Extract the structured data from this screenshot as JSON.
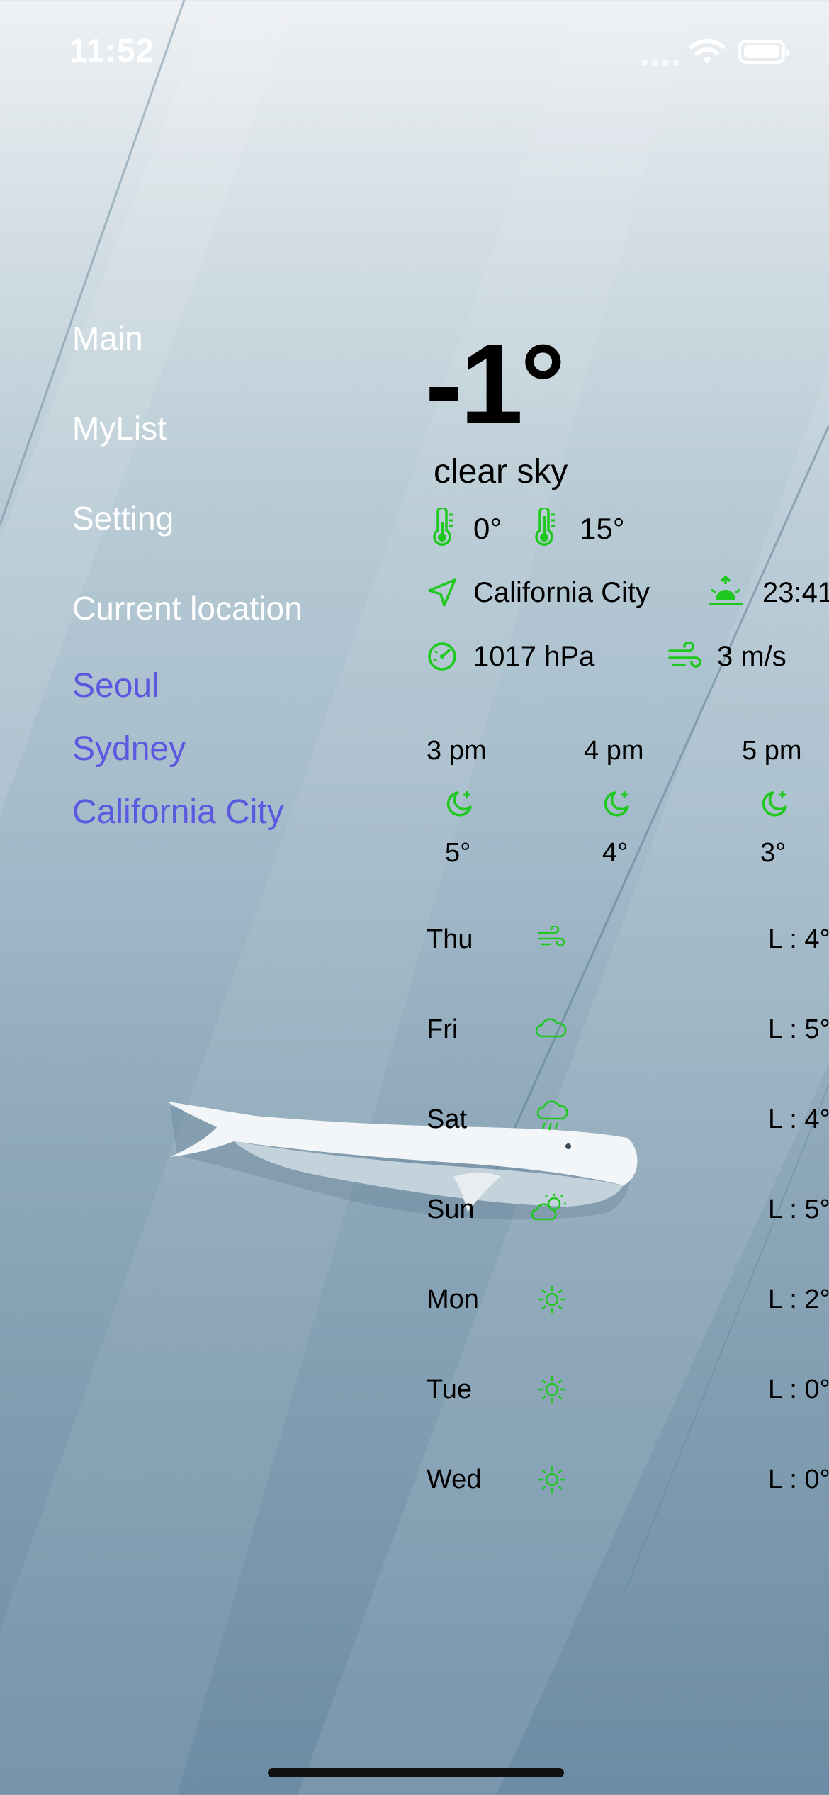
{
  "status_bar": {
    "time": "11:52"
  },
  "menu": {
    "items": [
      {
        "label": "Main"
      },
      {
        "label": "MyList"
      },
      {
        "label": "Setting"
      },
      {
        "label": "Current location"
      }
    ],
    "cities": [
      {
        "label": "Seoul"
      },
      {
        "label": "Sydney"
      },
      {
        "label": "California City"
      }
    ]
  },
  "weather": {
    "temp": "-1°",
    "description": "clear sky",
    "min_temp": "0°",
    "max_temp": "15°",
    "location": "California City",
    "sunrise": "23:41",
    "pressure": "1017 hPa",
    "wind": "3 m/s"
  },
  "hourly": [
    {
      "time": "3 pm",
      "temp": "5°",
      "icon": "moon-star-icon"
    },
    {
      "time": "4 pm",
      "temp": "4°",
      "icon": "moon-star-icon"
    },
    {
      "time": "5 pm",
      "temp": "3°",
      "icon": "moon-star-icon"
    }
  ],
  "daily": [
    {
      "day": "Thu",
      "icon": "wind-icon",
      "low": "L : 4°"
    },
    {
      "day": "Fri",
      "icon": "cloud-icon",
      "low": "L : 5°"
    },
    {
      "day": "Sat",
      "icon": "cloud-rain-icon",
      "low": "L : 4°"
    },
    {
      "day": "Sun",
      "icon": "partly-sunny-icon",
      "low": "L : 5°"
    },
    {
      "day": "Mon",
      "icon": "sun-icon",
      "low": "L : 2°"
    },
    {
      "day": "Tue",
      "icon": "sun-icon",
      "low": "L : 0°"
    },
    {
      "day": "Wed",
      "icon": "sun-icon",
      "low": "L : 0°"
    }
  ],
  "colors": {
    "accent_green": "#1ec81e",
    "city_link": "#5a59e0",
    "menu_text": "#ffffff"
  }
}
